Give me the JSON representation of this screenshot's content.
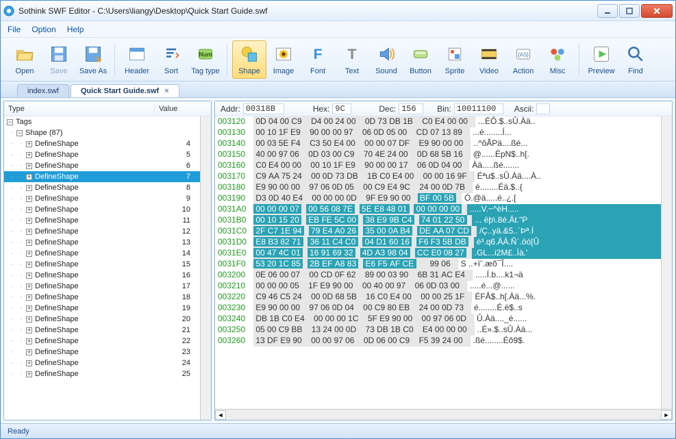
{
  "title": "Sothink SWF Editor - C:\\Users\\liangy\\Desktop\\Quick Start Guide.swf",
  "menu": [
    "File",
    "Option",
    "Help"
  ],
  "toolbar": [
    {
      "label": "Open",
      "name": "open-button",
      "icon": "open"
    },
    {
      "label": "Save",
      "name": "save-button",
      "icon": "save",
      "disabled": true
    },
    {
      "label": "Save As",
      "name": "saveas-button",
      "icon": "saveas"
    },
    {
      "sep": true
    },
    {
      "label": "Header",
      "name": "header-button",
      "icon": "header"
    },
    {
      "label": "Sort",
      "name": "sort-button",
      "icon": "sort"
    },
    {
      "label": "Tag type",
      "name": "tagtype-button",
      "icon": "tagtype"
    },
    {
      "sep": true
    },
    {
      "label": "Shape",
      "name": "shape-button",
      "icon": "shape",
      "active": true
    },
    {
      "label": "Image",
      "name": "image-button",
      "icon": "image"
    },
    {
      "label": "Font",
      "name": "font-button",
      "icon": "font"
    },
    {
      "label": "Text",
      "name": "text-button",
      "icon": "text"
    },
    {
      "label": "Sound",
      "name": "sound-button",
      "icon": "sound"
    },
    {
      "label": "Button",
      "name": "button-button",
      "icon": "button"
    },
    {
      "label": "Sprite",
      "name": "sprite-button",
      "icon": "sprite"
    },
    {
      "label": "Video",
      "name": "video-button",
      "icon": "video"
    },
    {
      "label": "Action",
      "name": "action-button",
      "icon": "action"
    },
    {
      "label": "Misc",
      "name": "misc-button",
      "icon": "misc"
    },
    {
      "sep": true
    },
    {
      "label": "Preview",
      "name": "preview-button",
      "icon": "preview"
    },
    {
      "label": "Find",
      "name": "find-button",
      "icon": "find"
    }
  ],
  "tabs": [
    {
      "label": "index.swf",
      "active": false
    },
    {
      "label": "Quick Start Guide.swf",
      "active": true
    }
  ],
  "columns": {
    "type": "Type",
    "value": "Value"
  },
  "tree": {
    "root": "Tags",
    "group": "Shape  (87)",
    "items": [
      {
        "label": "DefineShape",
        "value": "4"
      },
      {
        "label": "DefineShape",
        "value": "5"
      },
      {
        "label": "DefineShape",
        "value": "6"
      },
      {
        "label": "DefineShape",
        "value": "7",
        "selected": true
      },
      {
        "label": "DefineShape",
        "value": "8"
      },
      {
        "label": "DefineShape",
        "value": "9"
      },
      {
        "label": "DefineShape",
        "value": "10"
      },
      {
        "label": "DefineShape",
        "value": "11"
      },
      {
        "label": "DefineShape",
        "value": "12"
      },
      {
        "label": "DefineShape",
        "value": "13"
      },
      {
        "label": "DefineShape",
        "value": "14"
      },
      {
        "label": "DefineShape",
        "value": "15"
      },
      {
        "label": "DefineShape",
        "value": "16"
      },
      {
        "label": "DefineShape",
        "value": "17"
      },
      {
        "label": "DefineShape",
        "value": "18"
      },
      {
        "label": "DefineShape",
        "value": "19"
      },
      {
        "label": "DefineShape",
        "value": "20"
      },
      {
        "label": "DefineShape",
        "value": "21"
      },
      {
        "label": "DefineShape",
        "value": "22"
      },
      {
        "label": "DefineShape",
        "value": "23"
      },
      {
        "label": "DefineShape",
        "value": "24"
      },
      {
        "label": "DefineShape",
        "value": "25"
      }
    ]
  },
  "info": {
    "addr_label": "Addr:",
    "addr_value": "00318B",
    "hex_label": "Hex:",
    "hex_value": "9C",
    "dec_label": "Dec:",
    "dec_value": "156",
    "bin_label": "Bin:",
    "bin_value": "10011100",
    "ascii_label": "Ascii:",
    "ascii_value": ""
  },
  "hex": [
    {
      "addr": "003120",
      "g": [
        "0D 04 00 C9",
        "D4 00 24 00",
        "0D 73 DB 1B",
        "C0 E4 00 00"
      ],
      "a": "...ÉÔ.$..sÛ.Àä..",
      "sel": []
    },
    {
      "addr": "003130",
      "g": [
        "00 10 1F E9",
        "90 00 00 97",
        "06 0D 05 00",
        "CD 07 13 89"
      ],
      "a": "...é........Í...",
      "sel": []
    },
    {
      "addr": "003140",
      "g": [
        "00 03 5E F4",
        "C3 50 E4 00",
        "00 00 07 DF",
        "E9 90 00 00"
      ],
      "a": "..^ôÃPä....ßé...",
      "sel": []
    },
    {
      "addr": "003150",
      "g": [
        "40 00 97 06",
        "0D 03 00 C9",
        "70 4E 24 00",
        "0D 68 5B 16"
      ],
      "a": "@......ÉpN$..h[.",
      "sel": []
    },
    {
      "addr": "003160",
      "g": [
        "C0 E4 00 00",
        "00 10 1F E9",
        "90 00 00 17",
        "06 0D 04 00"
      ],
      "a": "Àä.....ßé.......",
      "sel": []
    },
    {
      "addr": "003170",
      "g": [
        "C9 AA 75 24",
        "00 0D 73 DB",
        "1B C0 E4 00",
        "00 00 16 9F"
      ],
      "a": "Éªu$..sÛ.Àä....À..",
      "sel": []
    },
    {
      "addr": "003180",
      "g": [
        "E9 90 00 00",
        "97 06 0D 05",
        "00 C9 E4 9C",
        "24 00 0D 7B"
      ],
      "a": "é........Éä.$..{",
      "sel": []
    },
    {
      "addr": "003190",
      "g": [
        "D3 0D 40 E4",
        "00 00 00 0D",
        "9F E9 90 00",
        "BF 00 5B"
      ],
      "a": "Ó.@ä.....é..¿.[",
      "sel": [
        [
          12,
          15
        ]
      ]
    },
    {
      "addr": "0031A0",
      "g": [
        "00 00 00 07",
        "00 56 08 7E",
        "5E E8 48 01",
        "00 00 00 00"
      ],
      "a": ".....V.~^èH.....",
      "sel": [
        [
          0,
          15
        ]
      ]
    },
    {
      "addr": "0031B0",
      "g": [
        "00 10 15 20",
        "EB FE 5C 00",
        "38 E9 9B C4",
        "74 01 22 50"
      ],
      "a": "... ëþ\\.8é.Ät.\"P",
      "sel": [
        [
          0,
          15
        ]
      ]
    },
    {
      "addr": "0031C0",
      "g": [
        "2F C7 1E 94",
        "79 E4 A0 26",
        "35 00 0A B4",
        "DE AA 07 CD"
      ],
      "a": "/Ç..yä.&5..´Þª.Í",
      "sel": [
        [
          0,
          15
        ]
      ]
    },
    {
      "addr": "0031D0",
      "g": [
        "E8 B3 82 71",
        "36 11 C4 C0",
        "04 D1 60 16",
        "F6 F3 5B DB"
      ],
      "a": "è³.q6.ÄÀ.Ñ`.öó[Û",
      "sel": [
        [
          0,
          15
        ]
      ]
    },
    {
      "addr": "0031E0",
      "g": [
        "00 47 4C 01",
        "16 91 69 32",
        "4D A3 98 04",
        "CC E0 08 27"
      ],
      "a": ".GL...i2M£..Ìà.'",
      "sel": [
        [
          0,
          15
        ]
      ]
    },
    {
      "addr": "0031F0",
      "g": [
        "53 20 1C 85",
        "2B EF A8 83",
        "E6 F5 AF CE",
        "   99 06"
      ],
      "a": "S ..+ï¨.æõ¯Î....",
      "sel": [
        [
          0,
          11
        ]
      ]
    },
    {
      "addr": "003200",
      "g": [
        "0E 06 00 07",
        "00 CD 0F 62",
        "89 00 03 90",
        "6B 31 AC E4"
      ],
      "a": ".....Í.b....k1¬ä",
      "sel": []
    },
    {
      "addr": "003210",
      "g": [
        "00 00 00 05",
        "1F E9 90 00",
        "00 40 00 97",
        "06 0D 03 00"
      ],
      "a": ".....é...@......",
      "sel": []
    },
    {
      "addr": "003220",
      "g": [
        "C9 46 C5 24",
        "00 0D 68 5B",
        "16 C0 E4 00",
        "00 00 25 1F"
      ],
      "a": "ÉFÅ$..h[.Àä...%.",
      "sel": []
    },
    {
      "addr": "003230",
      "g": [
        "E9 90 00 00",
        "97 06 0D 04",
        "00 C9 80 EB",
        "24 00 0D 73"
      ],
      "a": "é........É.ë$..s",
      "sel": []
    },
    {
      "addr": "003240",
      "g": [
        "DB 1B C0 E4",
        "00 00 00 1C",
        "5F E9 90 00",
        "00 97 06 0D"
      ],
      "a": "Û.Àä...._é......",
      "sel": []
    },
    {
      "addr": "003250",
      "g": [
        "05 00 C9 BB",
        "13 24 00 0D",
        "73 DB 1B C0",
        "E4 00 00 00"
      ],
      "a": "..É».$..sÛ.Àä...",
      "sel": []
    },
    {
      "addr": "003260",
      "g": [
        "13 DF E9 90",
        "00 00 97 06",
        "0D 06 00 C9",
        "F5 39 24 00"
      ],
      "a": ".ßé........Éõ9$.",
      "sel": []
    }
  ],
  "status": "Ready"
}
